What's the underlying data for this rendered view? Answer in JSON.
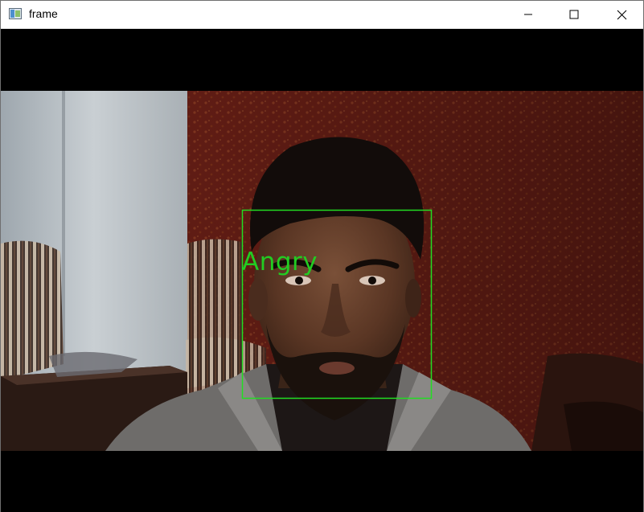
{
  "window": {
    "title": "frame",
    "icon": "image-window-icon",
    "controls": [
      "minimize-icon",
      "maximize-icon",
      "close-icon"
    ]
  },
  "detection": {
    "label": "Angry",
    "box_color": "#22dd22"
  }
}
